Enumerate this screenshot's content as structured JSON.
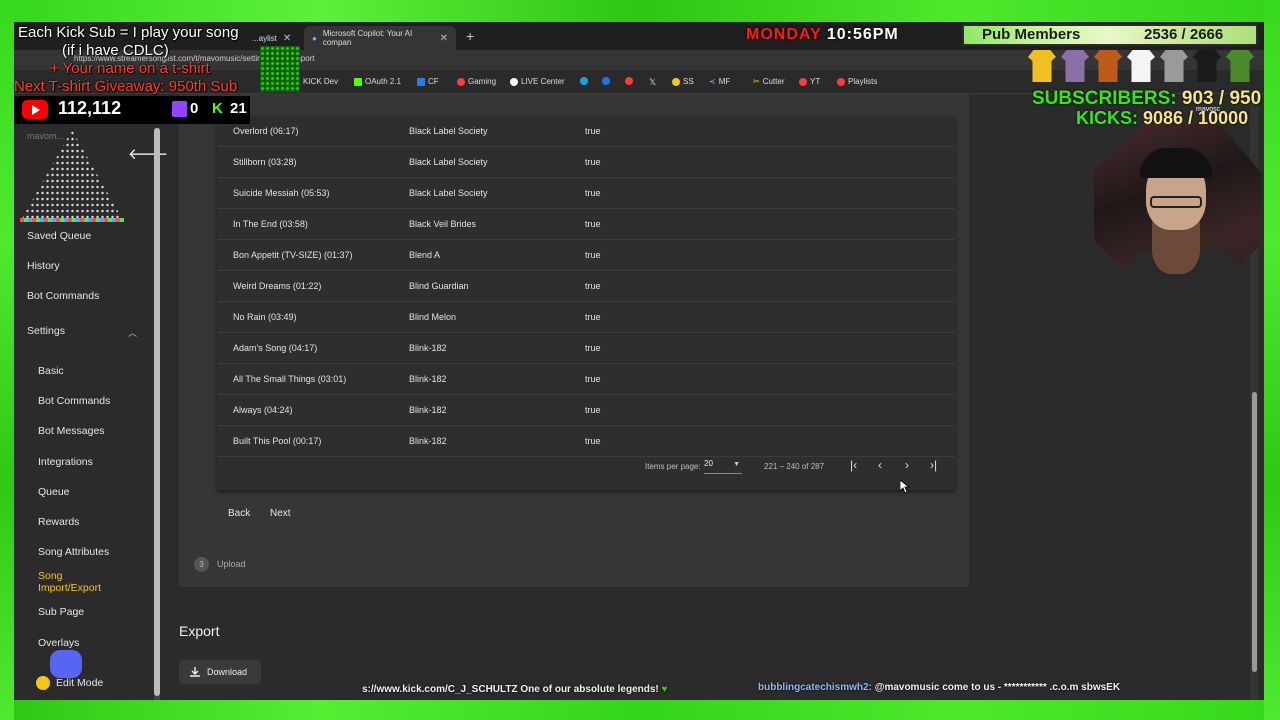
{
  "browser": {
    "tabs": [
      {
        "label": "...aylist"
      },
      {
        "label": "Microsoft Copilot: Your AI compan"
      }
    ],
    "url": "https://www.streamersonglist.com/t/mavomusic/settings/song-import",
    "bookmarks": [
      "KICK Dev",
      "OAuth 2.1",
      "CF",
      "Gaming",
      "LIVE Center",
      "SS",
      "MF",
      "Cutter",
      "YT",
      "Playlists"
    ]
  },
  "sidebar": {
    "items": [
      {
        "label": "Saved Queue"
      },
      {
        "label": "History"
      },
      {
        "label": "Bot Commands"
      },
      {
        "label": "Settings"
      },
      {
        "label": "Basic"
      },
      {
        "label": "Bot Commands"
      },
      {
        "label": "Bot Messages"
      },
      {
        "label": "Integrations"
      },
      {
        "label": "Queue"
      },
      {
        "label": "Rewards"
      },
      {
        "label": "Song Attributes"
      },
      {
        "label": "Song Import/Export"
      },
      {
        "label": "Sub Page"
      },
      {
        "label": "Overlays"
      },
      {
        "label": "Edit Mode"
      }
    ]
  },
  "table": {
    "rows": [
      {
        "title": "Overlord (06:17)",
        "artist": "Black Label Society",
        "flag": "true"
      },
      {
        "title": "Stillborn (03:28)",
        "artist": "Black Label Society",
        "flag": "true"
      },
      {
        "title": "Suicide Messiah (05:53)",
        "artist": "Black Label Society",
        "flag": "true"
      },
      {
        "title": "In The End (03:58)",
        "artist": "Black Veil Brides",
        "flag": "true"
      },
      {
        "title": "Bon Appetit (TV-SIZE) (01:37)",
        "artist": "Blend A",
        "flag": "true"
      },
      {
        "title": "Weird Dreams (01:22)",
        "artist": "Blind Guardian",
        "flag": "true"
      },
      {
        "title": "No Rain (03:49)",
        "artist": "Blind Melon",
        "flag": "true"
      },
      {
        "title": "Adam's Song (04:17)",
        "artist": "Blink-182",
        "flag": "true"
      },
      {
        "title": "All The Small Things (03:01)",
        "artist": "Blink-182",
        "flag": "true"
      },
      {
        "title": "Always (04:24)",
        "artist": "Blink-182",
        "flag": "true"
      },
      {
        "title": "Built This Pool (00:17)",
        "artist": "Blink-182",
        "flag": "true"
      }
    ],
    "pagination": {
      "items_per_page_label": "Items per page:",
      "items_per_page": "20",
      "range": "221 – 240 of 287"
    }
  },
  "stepper": {
    "back_label": "Back",
    "next_label": "Next",
    "step_number": "3",
    "step_label": "Upload"
  },
  "export": {
    "title": "Export",
    "download_label": "Download"
  },
  "overlay": {
    "line1": "Each Kick Sub = I play your song",
    "line2": "(if i have CDLC)",
    "line3": "+ Your name on a t-shirt",
    "line4": "Next T-shirt Giveaway: 950th Sub",
    "youtube_count": "112,112",
    "twitch_count": "0",
    "kick_count": "21",
    "day": "MONDAY",
    "time": "10:56PM",
    "pub_label": "Pub Members",
    "pub_count": "2536 / 2666",
    "subs_label": "SUBSCRIBERS:",
    "subs_value": "903 / 950",
    "kicks_label": "KICKS:",
    "kicks_value": "9086 / 10000",
    "handle": "mavosc",
    "faded_sidebar_text": "mavom..."
  },
  "ticker": {
    "left_url": "s://www.kick.com/C_J_SCHULTZ",
    "left_text": "One of our absolute legends!",
    "right_name": "bubblingcatechismwh2:",
    "right_text": "@mavomusic come to us - *********** .c.o.m sbwsEK"
  },
  "colors": {
    "chroma_green": "#3fe21f",
    "panel_bg": "#363636",
    "active_sidebar": "#f5c518",
    "youtube_red": "#ff0000",
    "twitch_purple": "#9146ff",
    "kick_green": "#53fc18"
  }
}
